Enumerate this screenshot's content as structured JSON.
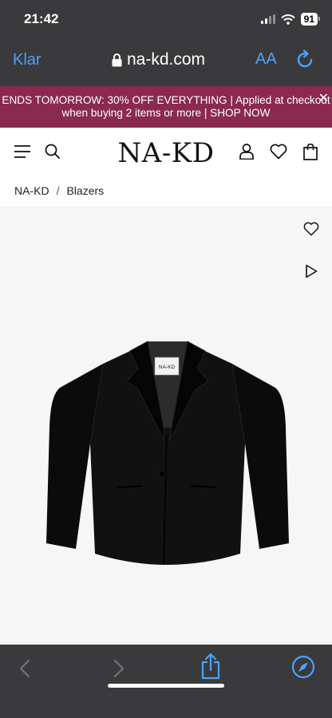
{
  "status_bar": {
    "time": "21:42",
    "battery": "91"
  },
  "browser": {
    "done_label": "Klar",
    "url": "na-kd.com",
    "text_size_label": "AA"
  },
  "promo": {
    "text_line1": "ENDS TOMORROW: 30% OFF EVERYTHING | Applied at checkout",
    "text_line2": "when buying 2 items or more | SHOP NOW"
  },
  "header": {
    "logo": "NA-KD"
  },
  "breadcrumb": {
    "items": [
      "NA-KD",
      "Blazers"
    ],
    "separator": "/"
  },
  "product": {
    "tag_label": "NA-KD",
    "image_alt": "Black single-button blazer"
  },
  "colors": {
    "promo_bg": "#8a2a4e",
    "ios_blue": "#4aa1ff",
    "chrome_bg": "#3a3a3c"
  },
  "icons": [
    "menu-icon",
    "search-icon",
    "account-icon",
    "wishlist-icon",
    "bag-icon",
    "heart-icon",
    "play-icon",
    "back-icon",
    "forward-icon",
    "share-icon",
    "compass-icon",
    "lock-icon",
    "reload-icon"
  ]
}
